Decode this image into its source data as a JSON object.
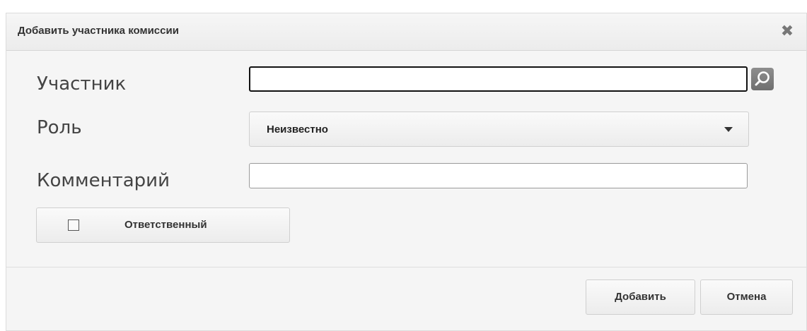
{
  "dialog": {
    "title": "Добавить участника комиссии",
    "close_icon": "close-icon"
  },
  "form": {
    "participant": {
      "label": "Участник",
      "value": "",
      "search_icon": "search-icon"
    },
    "role": {
      "label": "Роль",
      "selected": "Неизвестно",
      "dropdown_icon": "chevron-down-icon"
    },
    "comment": {
      "label": "Комментарий",
      "value": ""
    },
    "responsible": {
      "label": "Ответственный",
      "checked": false
    }
  },
  "footer": {
    "add_label": "Добавить",
    "cancel_label": "Отмена"
  }
}
